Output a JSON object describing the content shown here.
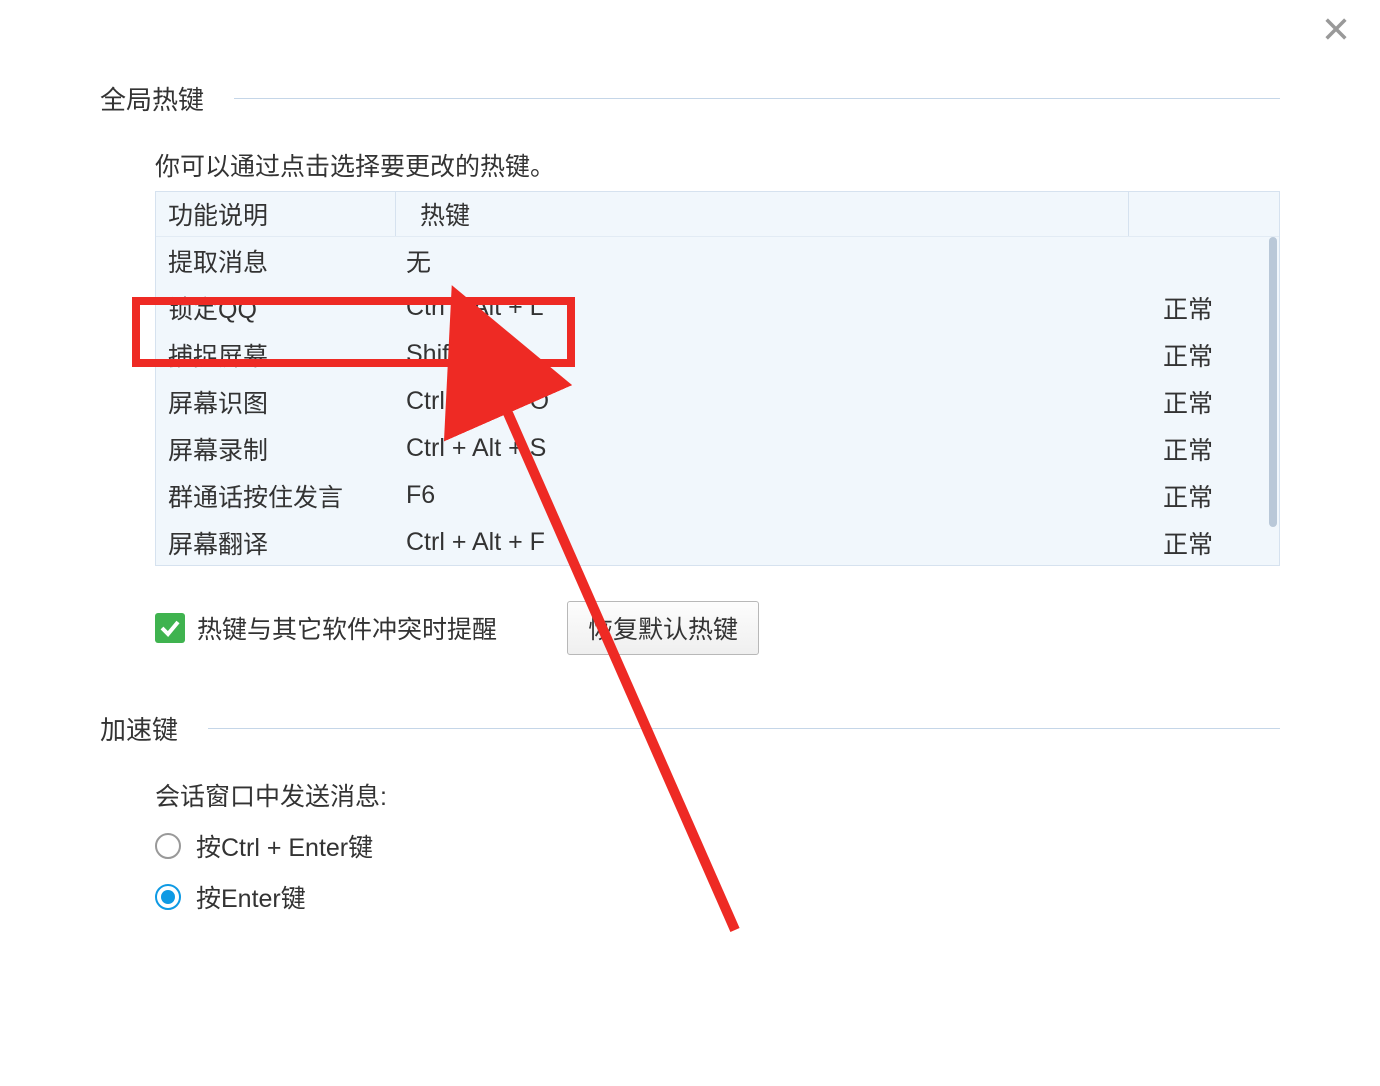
{
  "close": {
    "icon": "close-icon"
  },
  "section1": {
    "title": "全局热键",
    "intro": "你可以通过点击选择要更改的热键。",
    "headers": {
      "func": "功能说明",
      "key": "热键"
    },
    "rows": [
      {
        "func": "提取消息",
        "key": "无",
        "status": ""
      },
      {
        "func": "锁定QQ",
        "key": "Ctrl + Alt + L",
        "status": "正常"
      },
      {
        "func": "捕捉屏幕",
        "key": "Shift + Z",
        "status": "正常"
      },
      {
        "func": "屏幕识图",
        "key": "Ctrl + Alt + O",
        "status": "正常"
      },
      {
        "func": "屏幕录制",
        "key": "Ctrl + Alt + S",
        "status": "正常"
      },
      {
        "func": "群通话按住发言",
        "key": "F6",
        "status": "正常"
      },
      {
        "func": "屏幕翻译",
        "key": "Ctrl + Alt + F",
        "status": "正常"
      }
    ],
    "conflictLabel": "热键与其它软件冲突时提醒",
    "restoreLabel": "恢复默认热键"
  },
  "section2": {
    "title": "加速键",
    "groupTitle": "会话窗口中发送消息:",
    "options": [
      {
        "label": "按Ctrl + Enter键",
        "checked": false
      },
      {
        "label": "按Enter键",
        "checked": true
      }
    ]
  }
}
